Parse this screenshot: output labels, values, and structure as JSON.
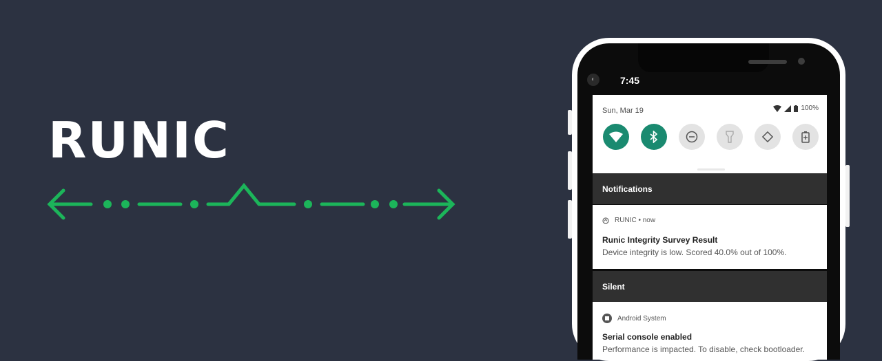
{
  "brand": {
    "title": "RUNIC"
  },
  "colors": {
    "background": "#2c3241",
    "accent_green": "#1cb55a",
    "qs_active": "#1a8a70"
  },
  "phone": {
    "status_time": "7:45",
    "quick_settings": {
      "date": "Sun, Mar 19",
      "battery": "100%",
      "tiles": [
        {
          "name": "wifi-icon",
          "active": true
        },
        {
          "name": "bluetooth-icon",
          "active": true
        },
        {
          "name": "do-not-disturb-icon",
          "active": false
        },
        {
          "name": "flashlight-icon",
          "active": false
        },
        {
          "name": "auto-rotate-icon",
          "active": false
        },
        {
          "name": "battery-saver-icon",
          "active": false
        }
      ]
    },
    "sections": {
      "notifications": "Notifications",
      "silent": "Silent"
    },
    "notification_runic": {
      "app": "RUNIC",
      "time": "• now",
      "title": "Runic Integrity Survey Result",
      "text": "Device integrity is low. Scored 40.0% out of 100%."
    },
    "notification_system": {
      "app": "Android System",
      "title": "Serial console enabled",
      "text": "Performance is impacted. To disable, check bootloader."
    }
  }
}
